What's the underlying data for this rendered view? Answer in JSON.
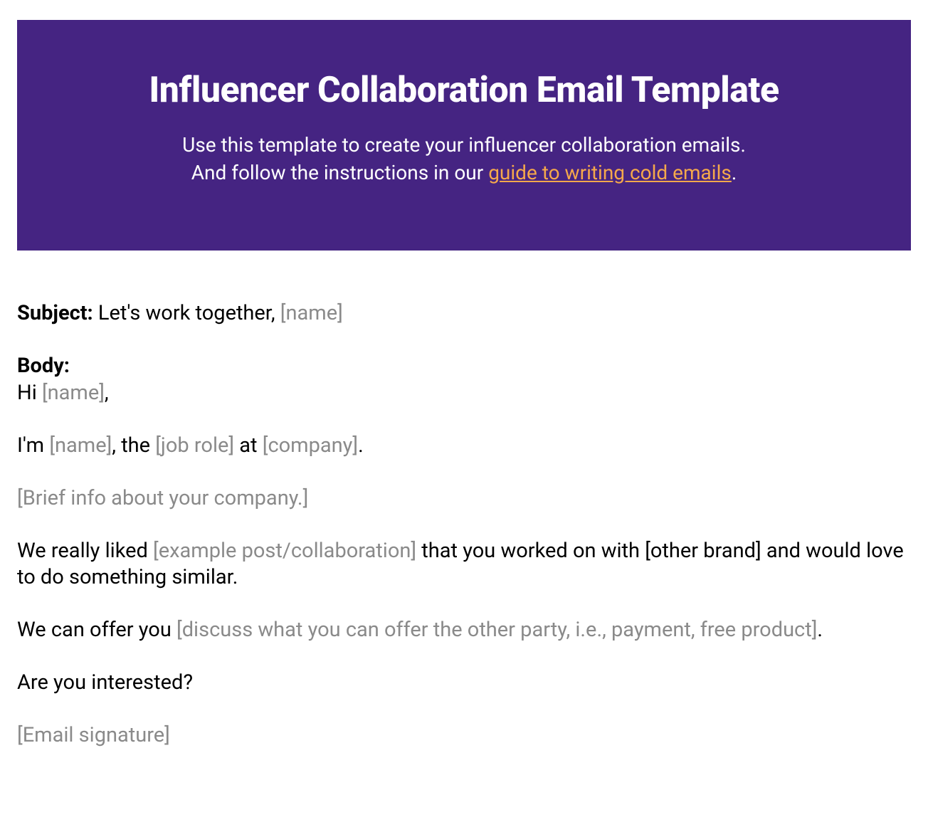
{
  "banner": {
    "title": "Influencer Collaboration Email Template",
    "subtitle_line1": "Use this template to create your influencer collaboration emails.",
    "subtitle_line2_prefix": "And follow the instructions in our ",
    "link_text": "guide to writing cold emails",
    "subtitle_line2_suffix": "."
  },
  "subject": {
    "label": "Subject:",
    "text_before": " Let's work together, ",
    "placeholder": "[name]"
  },
  "body": {
    "label": "Body:",
    "greeting_before": "Hi ",
    "greeting_placeholder": "[name]",
    "greeting_after": ",",
    "intro_before": "I'm ",
    "intro_name_placeholder": "[name]",
    "intro_mid1": ", the ",
    "intro_role_placeholder": "[job role]",
    "intro_mid2": " at ",
    "intro_company_placeholder": "[company]",
    "intro_after": ".",
    "company_info_placeholder": "[Brief info about your company.]",
    "liked_before": "We really liked ",
    "liked_placeholder": "[example post/collaboration]",
    "liked_after": " that you worked on with [other brand] and would love to do something similar.",
    "offer_before": "We can offer you ",
    "offer_placeholder": "[discuss what you can offer the other party, i.e., payment, free product]",
    "offer_after": ".",
    "closing_question": "Are you interested?",
    "signature_placeholder": "[Email signature]"
  }
}
